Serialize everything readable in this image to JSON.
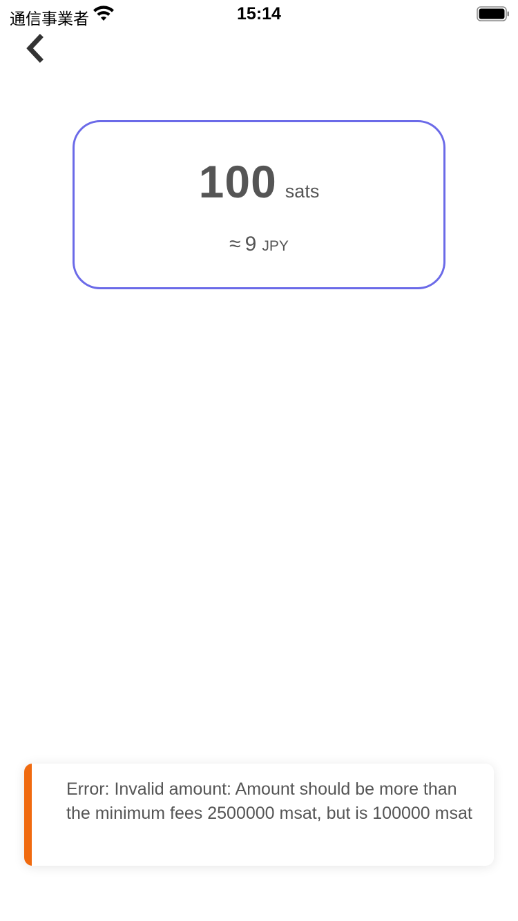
{
  "status_bar": {
    "carrier": "通信事業者",
    "time": "15:14"
  },
  "icons": {
    "wifi": "wifi-icon",
    "battery": "battery-icon",
    "back": "chevron-left-icon"
  },
  "amount_card": {
    "amount": "100",
    "unit": "sats",
    "approx_symbol": "≈",
    "fiat_amount": "9",
    "fiat_unit": "JPY"
  },
  "error_toast": {
    "message": "Error: Invalid amount: Amount should be more than the minimum fees 2500000 msat, but is 100000 msat"
  },
  "colors": {
    "card_border": "#6b6ae8",
    "toast_accent": "#f06a0f",
    "text_gray": "#555555"
  }
}
